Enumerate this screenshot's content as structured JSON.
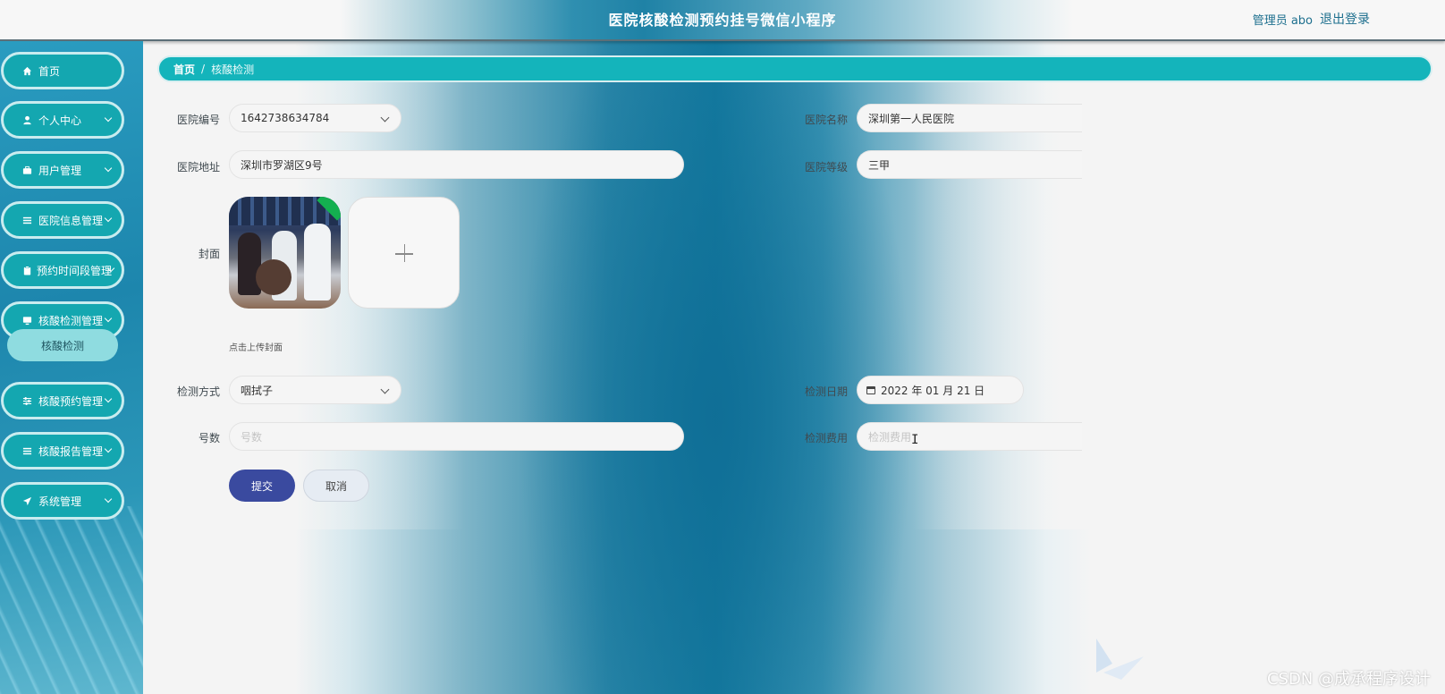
{
  "header": {
    "title": "医院核酸检测预约挂号微信小程序",
    "user_text": "管理员 abo",
    "logout_label": "退出登录"
  },
  "sidebar": {
    "items": [
      {
        "label": "首页",
        "icon": "home-icon",
        "has_chevron": false
      },
      {
        "label": "个人中心",
        "icon": "user-icon",
        "has_chevron": true
      },
      {
        "label": "用户管理",
        "icon": "briefcase-icon",
        "has_chevron": true
      },
      {
        "label": "医院信息管理",
        "icon": "list-icon",
        "has_chevron": true
      },
      {
        "label": "预约时间段管理",
        "icon": "clipboard-icon",
        "has_chevron": true
      },
      {
        "label": "核酸检测管理",
        "icon": "monitor-icon",
        "has_chevron": true
      },
      {
        "label": "核酸预约管理",
        "icon": "sliders-icon",
        "has_chevron": true
      },
      {
        "label": "核酸报告管理",
        "icon": "list-icon",
        "has_chevron": true
      },
      {
        "label": "系统管理",
        "icon": "send-icon",
        "has_chevron": true
      }
    ],
    "sub_item_label": "核酸检测"
  },
  "breadcrumb": {
    "home": "首页",
    "separator": "/",
    "current": "核酸检测"
  },
  "form": {
    "hospital_no": {
      "label": "医院编号",
      "value": "1642738634784"
    },
    "hospital_name": {
      "label": "医院名称",
      "value": "深圳第一人民医院"
    },
    "hospital_address": {
      "label": "医院地址",
      "value": "深圳市罗湖区9号"
    },
    "hospital_level": {
      "label": "医院等级",
      "value": "三甲"
    },
    "cover": {
      "label": "封面",
      "upload_tip": "点击上传封面"
    },
    "test_method": {
      "label": "检测方式",
      "value": "咽拭子"
    },
    "test_date": {
      "label": "检测日期",
      "value": "2022 年 01 月 21 日"
    },
    "number": {
      "label": "号数",
      "placeholder": "号数"
    },
    "fee": {
      "label": "检测费用",
      "placeholder": "检测费用"
    },
    "submit_label": "提交",
    "cancel_label": "取消"
  },
  "watermark": "CSDN @成承程序设计",
  "colors": {
    "accent": "#14b4bb",
    "submit": "#3a4a9f",
    "sidebar": "#1d86ad"
  }
}
